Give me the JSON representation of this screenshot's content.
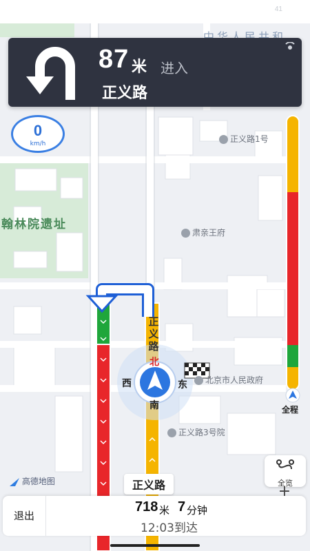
{
  "status_bar": {
    "indicator": "41"
  },
  "guidance": {
    "distance": "87",
    "distance_unit": "米",
    "action": "进入",
    "road": "正义路",
    "turn_icon": "u-turn-left-icon",
    "signal_icon": "gps-signal-icon"
  },
  "speed": {
    "value": "0",
    "unit": "km/h"
  },
  "map": {
    "labels": {
      "top_faint": "中华人民共和",
      "poi_1": "正义路1号",
      "place_park": "翰林院遗址",
      "poi_2": "肃亲王府",
      "poi_3": "北京市人民政府",
      "poi_4": "正义路3号院",
      "street_vertical": "正义路",
      "street_dir": "北"
    },
    "compass": {
      "west": "西",
      "east": "东",
      "south": "南"
    },
    "current_road": "正义路",
    "logo_text": "高德地图"
  },
  "route_progress": {
    "label": "全程",
    "colors": {
      "yellow": "#f5b400",
      "red": "#e8262a",
      "green": "#1fa63b"
    }
  },
  "controls": {
    "overview_label": "全览",
    "zoom_in": "+"
  },
  "bottom_bar": {
    "exit_label": "退出",
    "remaining_distance": "718",
    "remaining_distance_unit": "米",
    "remaining_time": "7",
    "remaining_time_unit": "分钟",
    "arrival": "12:03到达"
  }
}
